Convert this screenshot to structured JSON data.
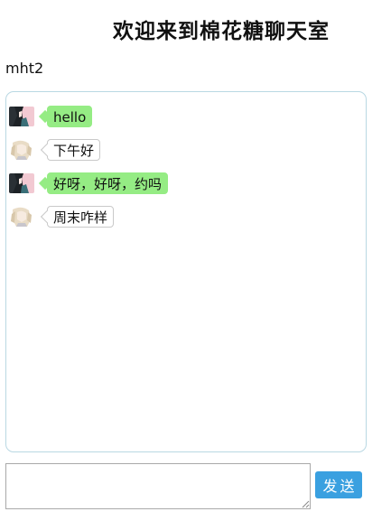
{
  "page": {
    "title": "欢迎来到棉花糖聊天室",
    "username": "mht2"
  },
  "messages": [
    {
      "sender": "self",
      "avatar": "avatar-dark-hair",
      "text": "hello"
    },
    {
      "sender": "other",
      "avatar": "avatar-light-hair",
      "text": "下午好"
    },
    {
      "sender": "self",
      "avatar": "avatar-dark-hair",
      "text": "好呀，好呀，约吗"
    },
    {
      "sender": "other",
      "avatar": "avatar-light-hair",
      "text": "周末咋样"
    }
  ],
  "composer": {
    "input_value": "",
    "send_label": "发送"
  },
  "colors": {
    "mine_bubble": "#95ec84",
    "other_bubble_border": "#c9c9c9",
    "chat_border": "#b9d8e3",
    "send_button": "#3aa0e0"
  }
}
